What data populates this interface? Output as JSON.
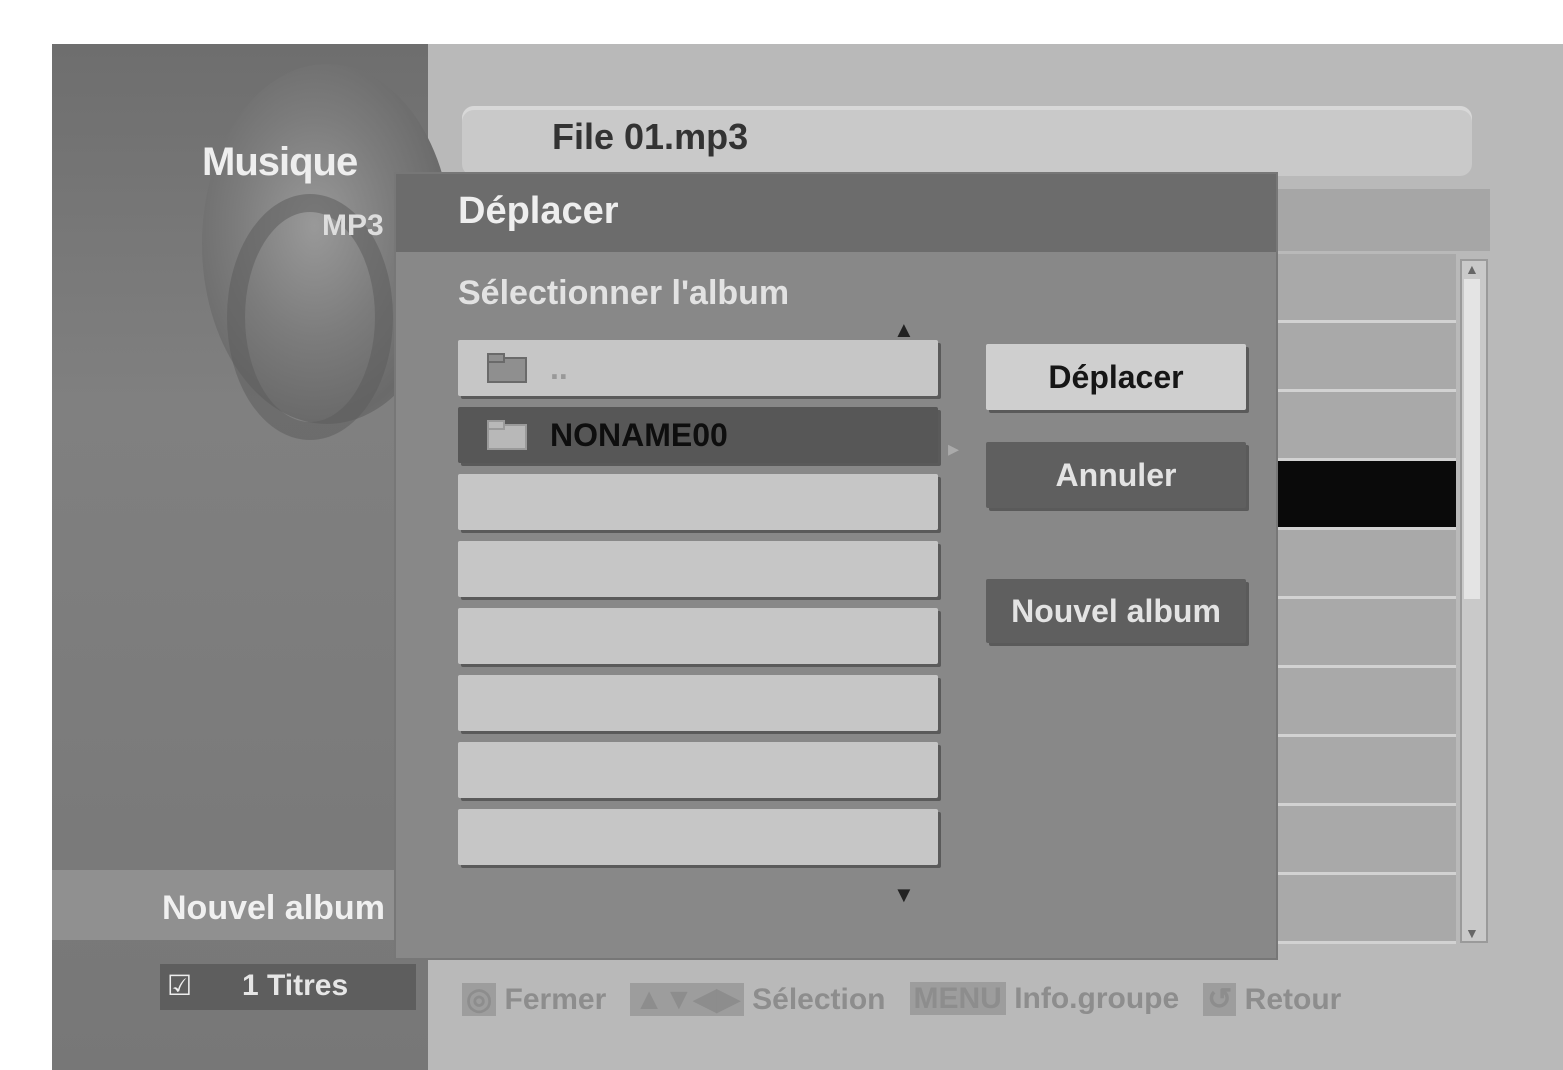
{
  "app": {
    "title": "Musique",
    "subtitle": "MP3"
  },
  "left_panel": {
    "selected_item_label": "Nouvel album",
    "track_count_label": "1 Titres"
  },
  "now_playing": {
    "file_name": "File 01.mp3"
  },
  "dialog": {
    "title": "Déplacer",
    "subtitle": "Sélectionner l'album",
    "albums": [
      {
        "label": ".."
      },
      {
        "label": "NONAME00"
      },
      {
        "label": ""
      },
      {
        "label": ""
      },
      {
        "label": ""
      },
      {
        "label": ""
      },
      {
        "label": ""
      },
      {
        "label": ""
      }
    ],
    "selected_album_index": 1,
    "buttons": {
      "move": "Déplacer",
      "cancel": "Annuler",
      "new_album": "Nouvel album"
    }
  },
  "hints": {
    "items": [
      {
        "key": "◎",
        "label": "Fermer"
      },
      {
        "key": "▲▼◀▶",
        "label": "Sélection"
      },
      {
        "key": "MENU",
        "label": "Info.groupe"
      },
      {
        "key": "↺",
        "label": "Retour"
      }
    ]
  },
  "colors": {
    "dialog_bg": "#888888",
    "selected_row": "#575757",
    "row_bg": "#c6c6c6"
  }
}
